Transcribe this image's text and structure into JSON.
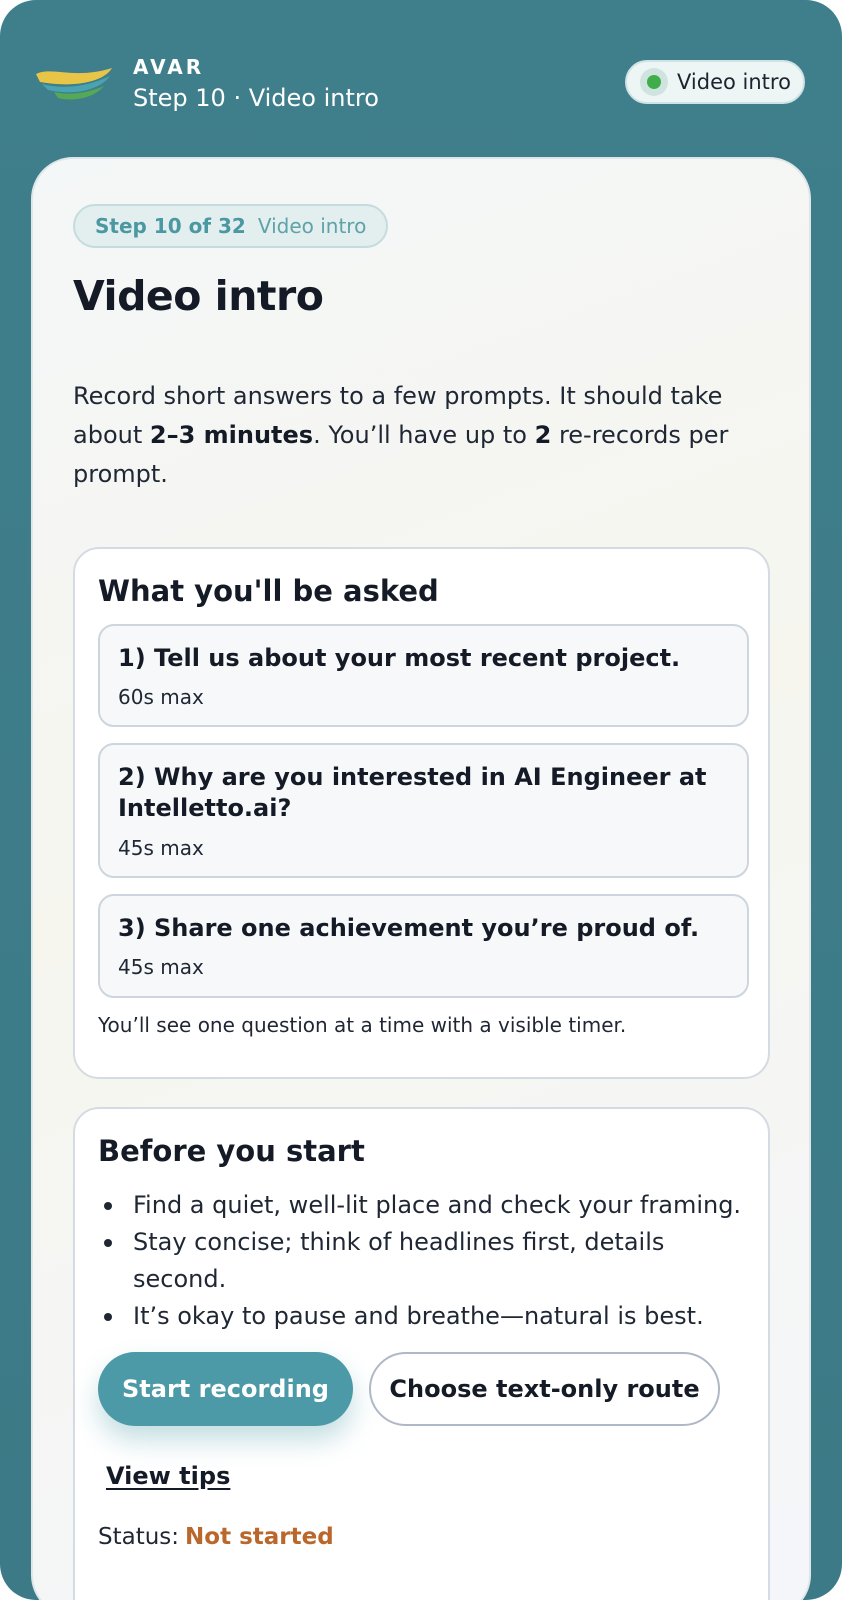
{
  "header": {
    "brand": "AVAR",
    "subtitle": "Step 10 · Video intro",
    "status_pill": "Video intro",
    "status_color": "#3fae4a"
  },
  "step_chip": {
    "counter": "Step 10 of 32",
    "label": "Video intro"
  },
  "page_title": "Video intro",
  "intro": {
    "part1": "Record short answers to a few prompts. It should take about ",
    "duration": "2–3 minutes",
    "part2": ". You’ll have up to ",
    "rerecords": "2",
    "part3": " re-records per prompt."
  },
  "questions_panel": {
    "heading": "What you'll be asked",
    "questions": [
      {
        "text": "1) Tell us about your most recent project.",
        "limit": "60s max"
      },
      {
        "text": "2) Why are you interested in AI Engineer at Intelletto.ai?",
        "limit": "45s max"
      },
      {
        "text": "3) Share one achievement you’re proud of.",
        "limit": "45s max"
      }
    ],
    "note": "You’ll see one question at a time with a visible timer."
  },
  "before_panel": {
    "heading": "Before you start",
    "tips": [
      "Find a quiet, well-lit place and check your framing.",
      "Stay concise; think of headlines first, details second.",
      "It’s okay to pause and breathe—natural is best."
    ],
    "primary_button": "Start recording",
    "secondary_button": "Choose text-only route",
    "tips_link": "View tips",
    "status_label": "Status:",
    "status_value": "Not started"
  },
  "colors": {
    "accent": "#4c9aa7",
    "frame": "#3f7e8b",
    "status_value": "#b9672a"
  }
}
